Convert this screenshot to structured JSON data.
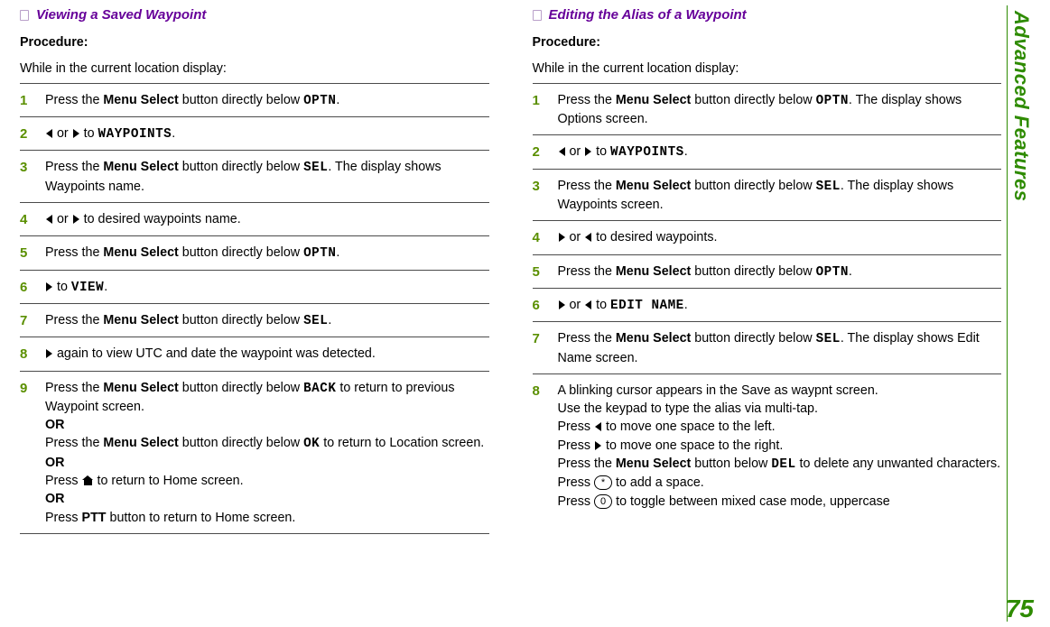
{
  "sidebar": {
    "label": "Advanced Features"
  },
  "page_number": "75",
  "labels": {
    "procedure": "Procedure:",
    "or": "OR",
    "while_in": "While in the current location display:",
    "menu_select": "Menu Select",
    "ptt": "PTT"
  },
  "mono": {
    "optn": "OPTN",
    "waypoints": "WAYPOINTS",
    "sel": "SEL",
    "view": "VIEW",
    "back": "BACK",
    "ok": "OK",
    "edit_name": "EDIT NAME",
    "del": "DEL"
  },
  "keys": {
    "star": "*",
    "zero": "0"
  },
  "left": {
    "title": "Viewing a Saved Waypoint",
    "s1_a": "Press the ",
    "s1_b": " button directly below ",
    "s1_c": ".",
    "s2_mid": " or ",
    "s2_to": " to ",
    "s3_a": "Press the ",
    "s3_b": " button directly below ",
    "s3_c": ". The display shows Waypoints name.",
    "s4_mid": " or ",
    "s4_b": " to desired waypoints name.",
    "s5_a": "Press the ",
    "s5_b": " button directly below ",
    "s5_c": ".",
    "s6_to": " to ",
    "s6_c": ".",
    "s7_a": "Press the ",
    "s7_b": " button directly below ",
    "s7_c": ".",
    "s8_a": " again to view UTC and date the waypoint was detected.",
    "s9_a": "Press the ",
    "s9_b": " button directly below ",
    "s9_c": " to return to previous Waypoint screen.",
    "s9_d": "Press the ",
    "s9_e": " button directly below ",
    "s9_f": " to return to Location screen.",
    "s9_g": "Press ",
    "s9_h": " to return to Home screen.",
    "s9_i": "Press ",
    "s9_j": " button to return to Home screen."
  },
  "right": {
    "title": "Editing the Alias of a Waypoint",
    "s1_a": "Press the ",
    "s1_b": " button directly below ",
    "s1_c": ". The display shows Options screen.",
    "s2_mid": " or ",
    "s2_to": " to ",
    "s3_a": "Press the ",
    "s3_b": " button directly below ",
    "s3_c": ". The display shows Waypoints screen.",
    "s4_mid": " or ",
    "s4_b": "  to desired waypoints.",
    "s5_a": "Press the ",
    "s5_b": " button directly below ",
    "s5_c": ".",
    "s6_mid": " or ",
    "s6_to": "  to ",
    "s6_c": ".",
    "s7_a": "Press the ",
    "s7_b": " button directly below ",
    "s7_c": ". The display shows Edit Name screen.",
    "s8_a": "A blinking cursor appears in the Save as waypnt screen.",
    "s8_b": "Use the keypad to type the alias via multi-tap.",
    "s8_c_pre": "Press ",
    "s8_c_post": " to move one space to the left.",
    "s8_d_pre": "Press ",
    "s8_d_post": " to move one space to the right.",
    "s8_e_pre": "Press the ",
    "s8_e_mid": " button below ",
    "s8_e_post": " to delete any unwanted characters.",
    "s8_f_pre": "Press ",
    "s8_f_post": " to add a space.",
    "s8_g_pre": "Press ",
    "s8_g_post": " to toggle between mixed case mode, uppercase"
  }
}
